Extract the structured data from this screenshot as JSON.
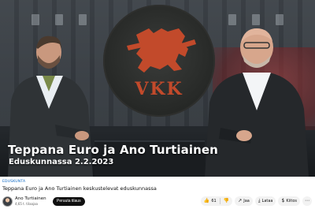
{
  "video": {
    "caption_title": "Teppana Euro ja Ano Turtiainen",
    "caption_subtitle": "Eduskunnassa 2.2.2023",
    "seal_text": "VKK"
  },
  "below": {
    "channel_tag": "EDUSKUNTA",
    "title": "Teppana Euro ja Ano Turtiainen keskustelevat eduskunnassa",
    "channel_name": "Ano Turtiainen",
    "subscribers": "4,65 t. tilaajaa",
    "subscribe_label": "Peruuta tilaus"
  },
  "actions": {
    "like_count": "61",
    "share_label": "Jaa",
    "download_label": "Lataa",
    "thanks_label": "Kiitos"
  },
  "icons": {
    "like": "thumb-up-icon",
    "dislike": "thumb-down-icon",
    "share": "share-icon",
    "download": "download-icon",
    "thanks": "thanks-icon",
    "more": "more-icon"
  },
  "colors": {
    "accent_link": "#0a66c2",
    "seal_emblem": "#c24a2b",
    "subscribe_bg": "#0f0f0f"
  }
}
